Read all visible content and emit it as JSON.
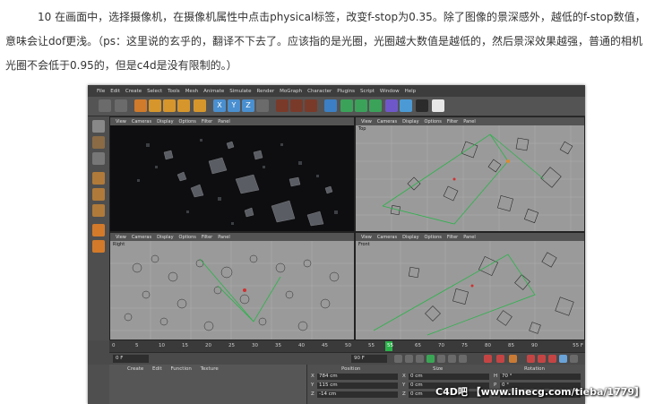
{
  "article": {
    "line1": "10 在画面中，选择摄像机，在摄像机属性中点击physical标签，改变f-stop为0.35。除了图像的景深感外，越低的f-stop数值，",
    "line2": "意味会让dof更浅。（ps：这里说的玄乎的，翻译不下去了。应该指的是光圈，光圈越大数值是越低的，然后景深效果越强，普通的相机",
    "line3": "光圈不会低于0.95的，但是c4d是没有限制的。）"
  },
  "menubar": [
    "File",
    "Edit",
    "Create",
    "Select",
    "Tools",
    "Mesh",
    "Animate",
    "Simulate",
    "Render",
    "MoGraph",
    "Character",
    "Plugins",
    "Script",
    "Window",
    "Help"
  ],
  "viewport_menu": [
    "View",
    "Cameras",
    "Display",
    "Options",
    "Filter",
    "Panel"
  ],
  "viewports": {
    "top_left": {
      "label": ""
    },
    "top_right": {
      "label": "Top"
    },
    "bottom_left": {
      "label": "Right"
    },
    "bottom_right": {
      "label": "Front"
    }
  },
  "timeline": {
    "ticks": [
      "0",
      "5",
      "10",
      "15",
      "20",
      "25",
      "30",
      "35",
      "40",
      "45",
      "50",
      "55",
      "60",
      "65",
      "70",
      "75",
      "80",
      "85",
      "90"
    ],
    "current_frame": "55",
    "end_label": "55 F"
  },
  "transport": {
    "start_field": "0 F",
    "end_field": "90 F"
  },
  "material_menu": [
    "Create",
    "Edit",
    "Function",
    "Texture"
  ],
  "coordinates": {
    "headers": {
      "position": "Position",
      "size": "Size",
      "rotation": "Rotation"
    },
    "rows": [
      {
        "axis": "X",
        "pos": "784 cm",
        "saxis": "X",
        "size": "0 cm",
        "raxis": "H",
        "rot": "70 °"
      },
      {
        "axis": "Y",
        "pos": "115 cm",
        "saxis": "Y",
        "size": "0 cm",
        "raxis": "P",
        "rot": "0 °"
      },
      {
        "axis": "Z",
        "pos": "-14 cm",
        "saxis": "Z",
        "size": "0 cm",
        "raxis": "B",
        "rot": "-41 °"
      }
    ]
  },
  "watermark": "C4D吧 【www.linecg.com/tieba/1779】",
  "colors": {
    "ui_dark": "#3d3d3d",
    "viewport_grey": "#9a9a9a",
    "selection_green": "#2bb34a",
    "accent_orange": "#e08a2a"
  }
}
